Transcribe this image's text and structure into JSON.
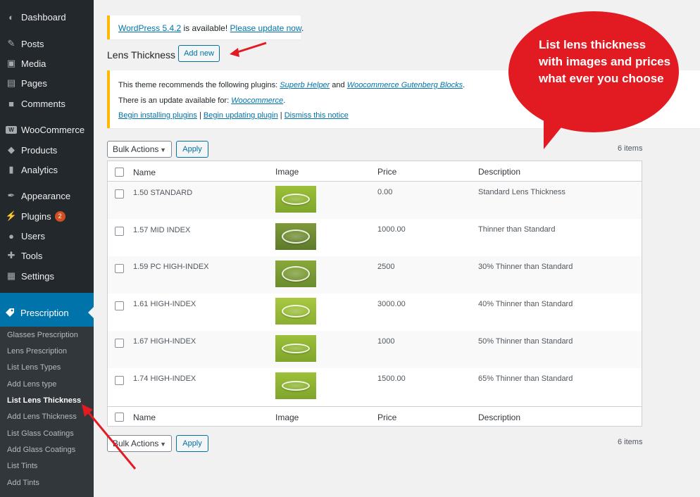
{
  "sidebar": {
    "items": [
      {
        "label": "Dashboard",
        "icon": "dashboard-icon",
        "glyph": "◐"
      },
      {
        "label": "Posts",
        "icon": "pin-icon",
        "glyph": "✎"
      },
      {
        "label": "Media",
        "icon": "media-icon",
        "glyph": "▣"
      },
      {
        "label": "Pages",
        "icon": "pages-icon",
        "glyph": "▤"
      },
      {
        "label": "Comments",
        "icon": "comments-icon",
        "glyph": "■"
      },
      {
        "label": "WooCommerce",
        "icon": "woocommerce-icon",
        "glyph": "W"
      },
      {
        "label": "Products",
        "icon": "products-icon",
        "glyph": "◆"
      },
      {
        "label": "Analytics",
        "icon": "analytics-icon",
        "glyph": "▮"
      },
      {
        "label": "Appearance",
        "icon": "appearance-icon",
        "glyph": "✒"
      },
      {
        "label": "Plugins",
        "icon": "plugins-icon",
        "glyph": "⚡",
        "badge": "2"
      },
      {
        "label": "Users",
        "icon": "users-icon",
        "glyph": "●"
      },
      {
        "label": "Tools",
        "icon": "tools-icon",
        "glyph": "✚"
      },
      {
        "label": "Settings",
        "icon": "settings-icon",
        "glyph": "▦"
      }
    ],
    "active": {
      "label": "Prescription",
      "icon": "tag-icon"
    },
    "submenu": [
      "Glasses Prescription",
      "Lens Prescription",
      "List Lens Types",
      "Add Lens type",
      "List Lens Thickness",
      "Add Lens Thickness",
      "List Glass Coatings",
      "Add Glass Coatings",
      "List Tints",
      "Add Tints"
    ],
    "current_submenu": "List Lens Thickness"
  },
  "update_notice": {
    "link1": "WordPress 5.4.2",
    "middle": " is available! ",
    "link2": "Please update now",
    "end": "."
  },
  "page": {
    "title": "Lens Thickness",
    "add_new": "Add new"
  },
  "plugin_notice": {
    "line1_prefix": "This theme recommends the following plugins: ",
    "plugin1": "Superb Helper",
    "and": " and ",
    "plugin2": "Woocommerce Gutenberg Blocks",
    "line1_end": ".",
    "line2_prefix": "There is an update available for: ",
    "plugin3": "Woocommerce",
    "line2_end": ".",
    "action1": "Begin installing plugins",
    "sep1": " | ",
    "action2": "Begin updating plugin",
    "sep2": " | ",
    "action3": "Dismiss this notice"
  },
  "bulk": {
    "select_label": "Bulk Actions",
    "apply": "Apply",
    "count": "6 items"
  },
  "table": {
    "headers": {
      "name": "Name",
      "image": "Image",
      "price": "Price",
      "description": "Description"
    },
    "rows": [
      {
        "name": "1.50 STANDARD",
        "price": "0.00",
        "description": "Standard Lens Thickness"
      },
      {
        "name": "1.57 MID INDEX",
        "price": "1000.00",
        "description": "Thinner than Standard"
      },
      {
        "name": "1.59 PC HIGH-INDEX",
        "price": "2500",
        "description": "30% Thinner than Standard"
      },
      {
        "name": "1.61 HIGH-INDEX",
        "price": "3000.00",
        "description": "40% Thinner than Standard"
      },
      {
        "name": "1.67 HIGH-INDEX",
        "price": "1000",
        "description": "50% Thinner than Standard"
      },
      {
        "name": "1.74 HIGH-INDEX",
        "price": "1500.00",
        "description": "65% Thinner than Standard"
      }
    ]
  },
  "callout": {
    "text": "List lens thickness with images and prices what ever you choose"
  },
  "colors": {
    "sidebar_bg": "#23282d",
    "active_bg": "#0073aa",
    "link": "#0073aa",
    "callout": "#e21b23",
    "notice_border": "#ffb900"
  }
}
